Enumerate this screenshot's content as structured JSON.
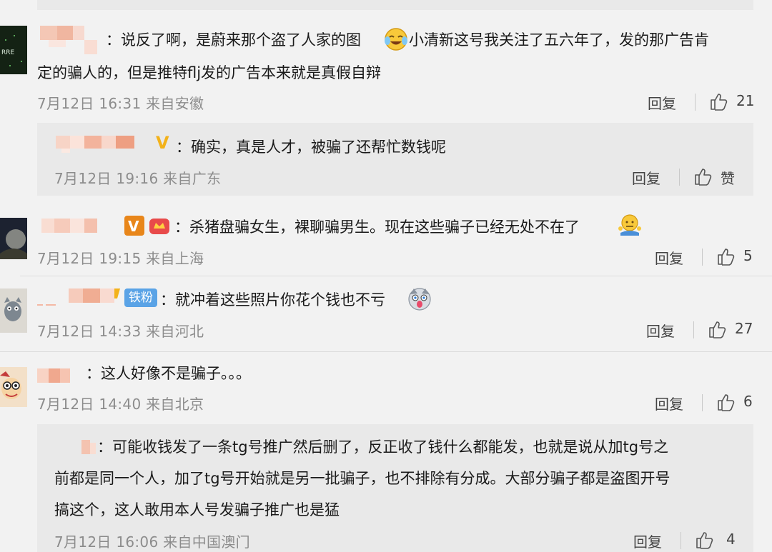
{
  "comments": [
    {
      "text_line1": "：说反了啊，是蔚来那个盗了人家的图",
      "text_line1b": "小清新这号我关注了五六年了，发的那广告肯",
      "text_line2": "定的骗人的，但是推特flj发的广告本来就是真假自辩",
      "time": "7月12日 16:31 来自安徽",
      "reply_label": "回复",
      "likes": "21",
      "emoji": "laughing-crying-emoji"
    },
    {
      "text": "：确实，真是人才，被骗了还帮忙数钱呢",
      "time": "7月12日 19:16 来自广东",
      "reply_label": "回复",
      "likes": "赞"
    },
    {
      "text": "：杀猪盘骗女生，裸聊骗男生。现在这些骗子已经无处不在了",
      "time": "7月12日 19:15 来自上海",
      "reply_label": "回复",
      "likes": "5",
      "emoji": "shrug-emoji"
    },
    {
      "fan_badge": "铁粉",
      "text": "：就冲着这些照片你花个钱也不亏",
      "time": "7月12日 14:33 来自河北",
      "reply_label": "回复",
      "likes": "27",
      "emoji": "husky-emoji"
    },
    {
      "text": "：这人好像不是骗子。。。",
      "time": "7月12日 14:40 来自北京",
      "reply_label": "回复",
      "likes": "6"
    },
    {
      "text_line1": "：可能收钱发了一条tg号推广然后删了，反正收了钱什么都能发，也就是说从加tg号之",
      "text_line2": "前都是同一个人，加了tg号开始就是另一批骗子，也不排除有分成。大部分骗子都是盗图开号",
      "text_line3": "搞这个，这人敢用本人号发骗子推广也是猛",
      "time": "7月12日 16:06 来自中国澳门",
      "reply_label": "回复",
      "likes": "4"
    }
  ],
  "colors": {
    "background": "#f2f2f2",
    "reply_panel": "#e9e9e9",
    "meta_text": "#8c8c8c",
    "vip_gold": "#f3b21a",
    "fan_badge": "#5aa3e6"
  }
}
